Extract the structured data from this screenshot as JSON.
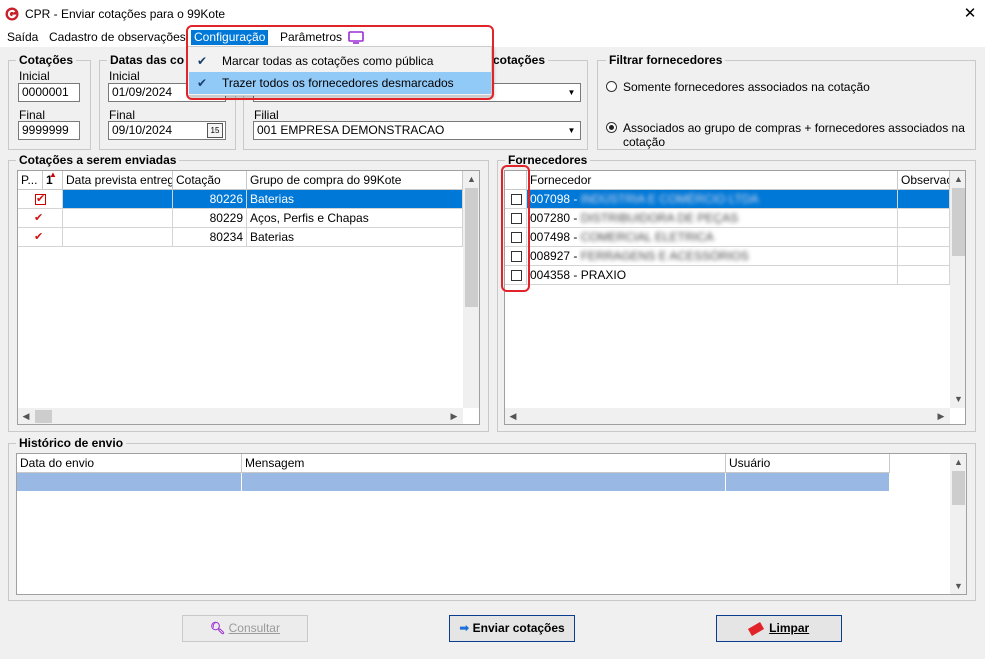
{
  "window": {
    "title": "CPR - Enviar cotações para o 99Kote",
    "close_glyph": "✕"
  },
  "menu": {
    "saida": "Saída",
    "cadastro": "Cadastro de observações",
    "configuracao": "Configuração",
    "parametros": "Parâmetros",
    "dropdown": [
      {
        "label": "Marcar todas as cotações como pública",
        "checked": true
      },
      {
        "label": "Trazer todos os fornecedores desmarcados",
        "checked": true
      }
    ]
  },
  "cotacoes_group": {
    "title": "Cotações",
    "inicial_label": "Inicial",
    "inicial_value": "0000001",
    "final_label": "Final",
    "final_value": "9999999"
  },
  "datas_group": {
    "title": "Datas das co",
    "inicial_label": "Inicial",
    "inicial_value": "01/09/2024",
    "final_label": "Final",
    "final_value": "09/10/2024",
    "cal_glyph": "15"
  },
  "config_group": {
    "title": "s cotações",
    "filial_label": "Filial",
    "filial_value": "001 EMPRESA DEMONSTRACAO",
    "top_value": ""
  },
  "filtrar_group": {
    "title": "Filtrar fornecedores",
    "options": [
      {
        "label": "Somente fornecedores associados na cotação",
        "selected": false
      },
      {
        "label": "Associados ao grupo de compras + fornecedores associados na cotação",
        "selected": true
      }
    ]
  },
  "cotacoes_enviadas": {
    "title": "Cotações a serem enviadas",
    "columns": [
      "P...",
      "1",
      "Data prevista entrega",
      "Cotação",
      "Grupo de compra do 99Kote"
    ],
    "rows": [
      {
        "checked": true,
        "data": "",
        "cotacao": "80226",
        "grupo": "Baterias",
        "selected": true
      },
      {
        "checked": true,
        "data": "",
        "cotacao": "80229",
        "grupo": "Aços, Perfis e Chapas",
        "selected": false
      },
      {
        "checked": true,
        "data": "",
        "cotacao": "80234",
        "grupo": "Baterias",
        "selected": false
      }
    ]
  },
  "fornecedores": {
    "title": "Fornecedores",
    "columns": [
      "Fornecedor",
      "Observaçã"
    ],
    "rows": [
      {
        "code": "007098 -",
        "name": "INDÚSTRIA E COMÉRCIO LTDA",
        "blurred": true,
        "selected": true
      },
      {
        "code": "007280 -",
        "name": "DISTRIBUIDORA DE PEÇAS",
        "blurred": true,
        "selected": false
      },
      {
        "code": "007498 -",
        "name": "COMERCIAL ELETRICA",
        "blurred": true,
        "selected": false
      },
      {
        "code": "008927 -",
        "name": "FERRAGENS E ACESSÓRIOS",
        "blurred": true,
        "selected": false
      },
      {
        "code": "004358 -",
        "name": "PRAXIO",
        "blurred": false,
        "selected": false
      }
    ]
  },
  "historico": {
    "title": "Histórico de envio",
    "columns": [
      "Data do envio",
      "Mensagem",
      "Usuário"
    ]
  },
  "buttons": {
    "consultar": "Consultar",
    "enviar": "Enviar cotações",
    "limpar": "Limpar"
  },
  "colors": {
    "accent": "#0078d7",
    "highlight": "#e0242a",
    "hover": "#91c9f7"
  }
}
